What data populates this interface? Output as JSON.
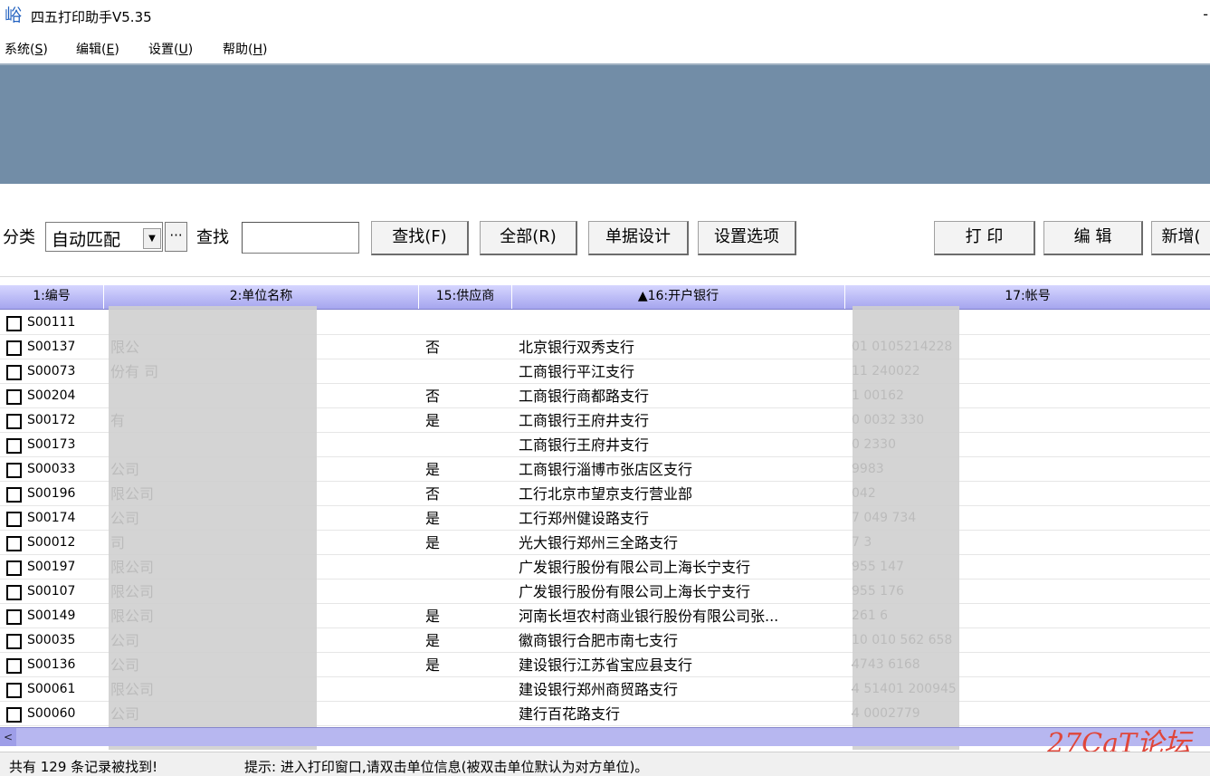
{
  "window": {
    "title": "四五打印助手V5.35",
    "app_icon": "峪",
    "title_dash": "-"
  },
  "menu": [
    {
      "text": "系统(",
      "key": "S",
      "end": ")"
    },
    {
      "text": "编辑(",
      "key": "E",
      "end": ")"
    },
    {
      "text": "设置(",
      "key": "U",
      "end": ")"
    },
    {
      "text": "帮助(",
      "key": "H",
      "end": ")"
    }
  ],
  "toolbar": {
    "category_label": "分类",
    "category_value": "自动匹配",
    "ellipsis": "···",
    "search_label": "查找",
    "search_value": "",
    "find_button": "查找(F)",
    "all_button": "全部(R)",
    "design_button": "单据设计",
    "options_button": "设置选项",
    "print_button": "打 印",
    "edit_button": "编 辑",
    "add_button": "新增("
  },
  "table": {
    "columns": [
      "1:编号",
      "2:单位名称",
      "15:供应商",
      "▲16:开户银行",
      "17:帐号"
    ],
    "rows": [
      {
        "code": "S00111",
        "name": "",
        "supplier": "",
        "bank": "",
        "account": ""
      },
      {
        "code": "S00137",
        "name": "限公",
        "supplier": "否",
        "bank": "北京银行双秀支行",
        "account": "01   0105214228"
      },
      {
        "code": "S00073",
        "name": "份有 司",
        "supplier": "",
        "bank": "工商银行平江支行",
        "account": "11  240022"
      },
      {
        "code": "S00204",
        "name": "",
        "supplier": "否",
        "bank": "工商银行商都路支行",
        "account": "1  00162"
      },
      {
        "code": "S00172",
        "name": "有",
        "supplier": "是",
        "bank": "工商银行王府井支行",
        "account": "0  0032 330"
      },
      {
        "code": "S00173",
        "name": "",
        "supplier": "",
        "bank": "工商银行王府井支行",
        "account": "0  2330"
      },
      {
        "code": "S00033",
        "name": "公司",
        "supplier": "是",
        "bank": "工商银行淄博市张店区支行",
        "account": "9983"
      },
      {
        "code": "S00196",
        "name": "限公司",
        "supplier": "否",
        "bank": "工行北京市望京支行营业部",
        "account": "042"
      },
      {
        "code": "S00174",
        "name": "公司",
        "supplier": "是",
        "bank": "工行郑州健设路支行",
        "account": "7  049 734"
      },
      {
        "code": "S00012",
        "name": "司",
        "supplier": "是",
        "bank": "光大银行郑州三全路支行",
        "account": "7  3"
      },
      {
        "code": "S00197",
        "name": "限公司",
        "supplier": "",
        "bank": "广发银行股份有限公司上海长宁支行",
        "account": "955  147"
      },
      {
        "code": "S00107",
        "name": "限公司",
        "supplier": "",
        "bank": "广发银行股份有限公司上海长宁支行",
        "account": "955  176"
      },
      {
        "code": "S00149",
        "name": "限公司",
        "supplier": "是",
        "bank": "河南长垣农村商业银行股份有限公司张...",
        "account": "261  6"
      },
      {
        "code": "S00035",
        "name": "公司",
        "supplier": "是",
        "bank": "徽商银行合肥市南七支行",
        "account": "10  010  562 658"
      },
      {
        "code": "S00136",
        "name": "公司",
        "supplier": "是",
        "bank": "建设银行江苏省宝应县支行",
        "account": "4743  6168"
      },
      {
        "code": "S00061",
        "name": "限公司",
        "supplier": "",
        "bank": "建设银行郑州商贸路支行",
        "account": "4  51401  200945"
      },
      {
        "code": "S00060",
        "name": "公司",
        "supplier": "",
        "bank": "建行百花路支行",
        "account": "4  0002779"
      }
    ]
  },
  "status": {
    "records": "共有 129 条记录被找到!",
    "tip": "提示: 进入打印窗口,请双击单位信息(被双击单位默认为对方单位)。"
  },
  "watermark": "27CaT论坛",
  "scroll_left_glyph": "<",
  "colors": {
    "banner": "#728da7",
    "header": "#b0b0f0"
  }
}
